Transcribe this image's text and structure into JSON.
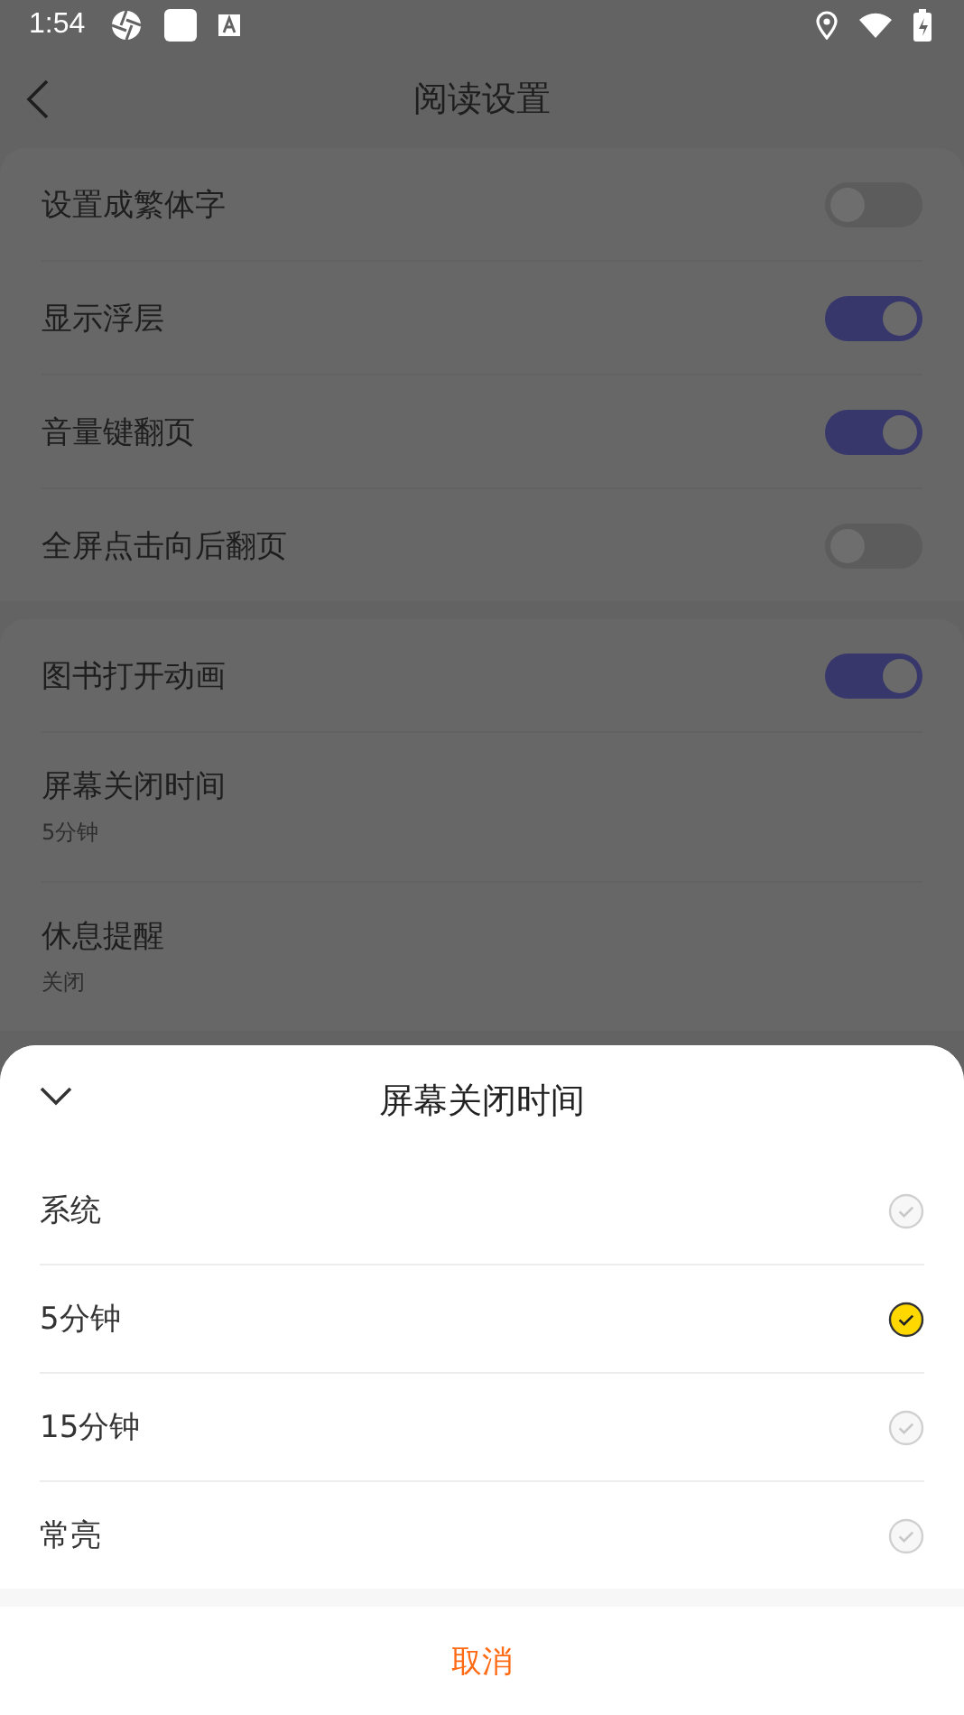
{
  "status_bar": {
    "time": "1:54"
  },
  "header": {
    "title": "阅读设置"
  },
  "settings_groups": [
    {
      "items": [
        {
          "kind": "toggle",
          "label": "设置成繁体字",
          "on": false
        },
        {
          "kind": "toggle",
          "label": "显示浮层",
          "on": true
        },
        {
          "kind": "toggle",
          "label": "音量键翻页",
          "on": true
        },
        {
          "kind": "toggle",
          "label": "全屏点击向后翻页",
          "on": false
        }
      ]
    },
    {
      "items": [
        {
          "kind": "toggle",
          "label": "图书打开动画",
          "on": true
        },
        {
          "kind": "value",
          "label": "屏幕关闭时间",
          "value": "5分钟"
        },
        {
          "kind": "value",
          "label": "休息提醒",
          "value": "关闭"
        }
      ]
    }
  ],
  "sheet": {
    "title": "屏幕关闭时间",
    "options": [
      {
        "label": "系统",
        "selected": false
      },
      {
        "label": "5分钟",
        "selected": true
      },
      {
        "label": "15分钟",
        "selected": false
      },
      {
        "label": "常亮",
        "selected": false
      }
    ],
    "cancel": "取消"
  }
}
